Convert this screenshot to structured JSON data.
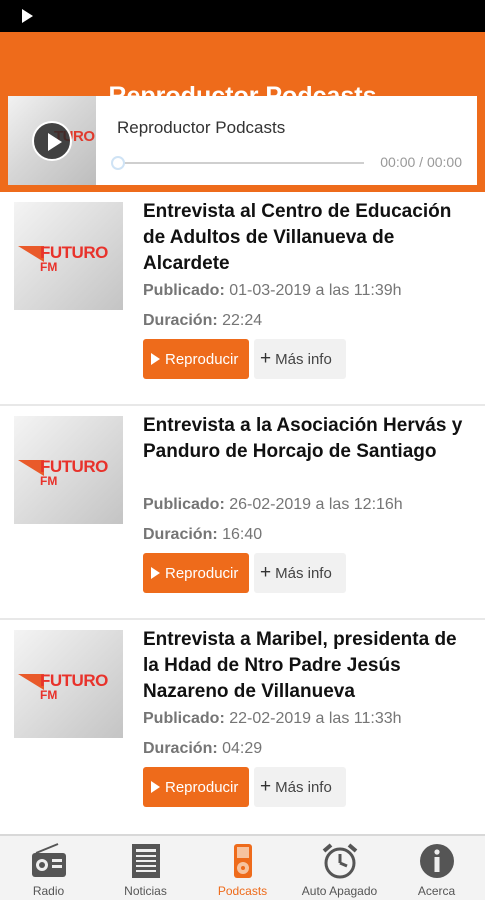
{
  "header": {
    "title": "Reproductor Podcasts"
  },
  "player": {
    "label": "Reproductor Podcasts",
    "thumb_text": "TURO",
    "time": "00:00 / 00:00",
    "progress": 0
  },
  "podcasts": [
    {
      "title": "Entrevista al Centro de Educación de Adultos de Villanueva de Alcardete",
      "published_label": "Publicado:",
      "published": "01-03-2019 a las 11:39h",
      "duration_label": "Duración:",
      "duration": "22:24",
      "logo_text": "FUTURO",
      "logo_sub": "FM",
      "play_label": "Reproducir",
      "info_label": "Más info"
    },
    {
      "title": "Entrevista a la Asociación Hervás y Panduro de Horcajo de Santiago",
      "published_label": "Publicado:",
      "published": "26-02-2019 a las 12:16h",
      "duration_label": "Duración:",
      "duration": "16:40",
      "logo_text": "FUTURO",
      "logo_sub": "FM",
      "play_label": "Reproducir",
      "info_label": "Más info"
    },
    {
      "title": "Entrevista a Maribel, presidenta de la Hdad de Ntro Padre Jesús Nazareno de Villanueva",
      "published_label": "Publicado:",
      "published": "22-02-2019 a las 11:33h",
      "duration_label": "Duración:",
      "duration": "04:29",
      "logo_text": "FUTURO",
      "logo_sub": "FM",
      "play_label": "Reproducir",
      "info_label": "Más info"
    }
  ],
  "tabs": [
    {
      "label": "Radio",
      "icon": "radio-icon",
      "active": false
    },
    {
      "label": "Noticias",
      "icon": "newspaper-icon",
      "active": false
    },
    {
      "label": "Podcasts",
      "icon": "ipod-icon",
      "active": true
    },
    {
      "label": "Auto Apagado",
      "icon": "alarm-clock-icon",
      "active": false
    },
    {
      "label": "Acerca",
      "icon": "info-icon",
      "active": false
    }
  ],
  "colors": {
    "accent": "#ee6b1b",
    "logo_red": "#e8322b",
    "tab_bg": "#f3f3f3"
  }
}
